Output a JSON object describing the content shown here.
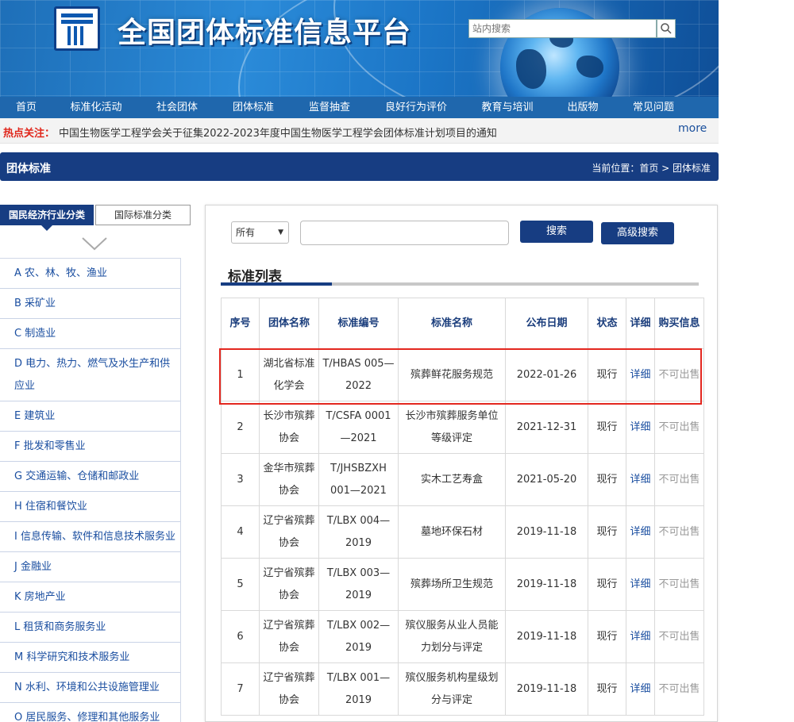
{
  "header": {
    "site_title": "全国团体标准信息平台",
    "search_placeholder": "站内搜索"
  },
  "nav": [
    {
      "label": "首页"
    },
    {
      "label": "标准化活动"
    },
    {
      "label": "社会团体"
    },
    {
      "label": "团体标准"
    },
    {
      "label": "监督抽查"
    },
    {
      "label": "良好行为评价"
    },
    {
      "label": "教育与培训"
    },
    {
      "label": "出版物"
    },
    {
      "label": "常见问题"
    }
  ],
  "hotline": {
    "label": "热点关注：",
    "message": "中国生物医学工程学会关于征集2022-2023年度中国生物医学工程学会团体标准计划项目的通知",
    "more": "more"
  },
  "section": {
    "title": "团体标准",
    "breadcrumb": "当前位置：首页 > 团体标准"
  },
  "sidebar": {
    "tab_active": "国民经济行业分类",
    "tab_inactive": "国际标准分类",
    "categories": [
      "A 农、林、牧、渔业",
      "B 采矿业",
      "C 制造业",
      "D 电力、热力、燃气及水生产和供应业",
      "E 建筑业",
      "F 批发和零售业",
      "G 交通运输、仓储和邮政业",
      "H 住宿和餐饮业",
      "I 信息传输、软件和信息技术服务业",
      "J 金融业",
      "K 房地产业",
      "L 租赁和商务服务业",
      "M 科学研究和技术服务业",
      "N 水利、环境和公共设施管理业",
      "O 居民服务、修理和其他服务业"
    ]
  },
  "search": {
    "select_value": "所有",
    "search_button": "搜索",
    "advanced_button": "高级搜索"
  },
  "list": {
    "title": "标准列表",
    "headers": [
      "序号",
      "团体名称",
      "标准编号",
      "标准名称",
      "公布日期",
      "状态",
      "详细",
      "购买信息"
    ],
    "rows": [
      {
        "no": "1",
        "org": "湖北省标准化学会",
        "code": "T/HBAS 005—2022",
        "name": "殡葬鲜花服务规范",
        "date": "2022-01-26",
        "status": "现行",
        "detail": "详细",
        "buy": "不可出售"
      },
      {
        "no": "2",
        "org": "长沙市殡葬协会",
        "code": "T/CSFA 0001—2021",
        "name": "长沙市殡葬服务单位等级评定",
        "date": "2021-12-31",
        "status": "现行",
        "detail": "详细",
        "buy": "不可出售"
      },
      {
        "no": "3",
        "org": "金华市殡葬协会",
        "code": "T/JHSBZXH 001—2021",
        "name": "实木工艺寿盒",
        "date": "2021-05-20",
        "status": "现行",
        "detail": "详细",
        "buy": "不可出售"
      },
      {
        "no": "4",
        "org": "辽宁省殡葬协会",
        "code": "T/LBX 004—2019",
        "name": "墓地环保石材",
        "date": "2019-11-18",
        "status": "现行",
        "detail": "详细",
        "buy": "不可出售"
      },
      {
        "no": "5",
        "org": "辽宁省殡葬协会",
        "code": "T/LBX 003—2019",
        "name": "殡葬场所卫生规范",
        "date": "2019-11-18",
        "status": "现行",
        "detail": "详细",
        "buy": "不可出售"
      },
      {
        "no": "6",
        "org": "辽宁省殡葬协会",
        "code": "T/LBX 002—2019",
        "name": "殡仪服务从业人员能力划分与评定",
        "date": "2019-11-18",
        "status": "现行",
        "detail": "详细",
        "buy": "不可出售"
      },
      {
        "no": "7",
        "org": "辽宁省殡葬协会",
        "code": "T/LBX 001—2019",
        "name": "殡仪服务机构星级划分与评定",
        "date": "2019-11-18",
        "status": "现行",
        "detail": "详细",
        "buy": "不可出售"
      }
    ]
  }
}
